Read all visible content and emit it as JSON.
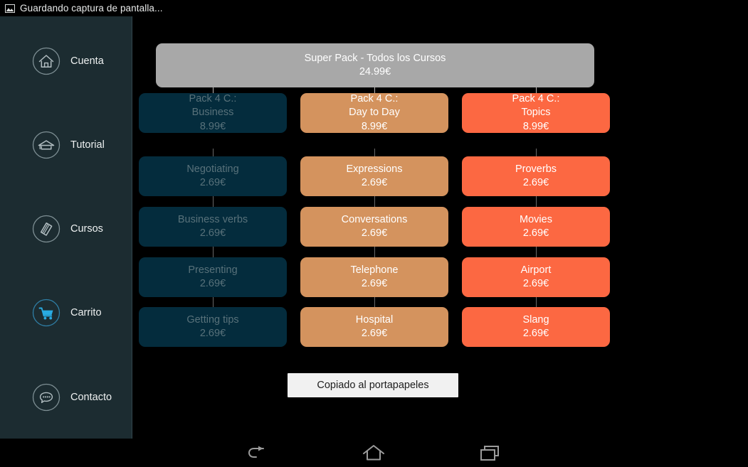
{
  "status_bar": {
    "icon": "screenshot-image-icon",
    "text": "Guardando captura de pantalla..."
  },
  "sidebar": {
    "background": "#1c2c31",
    "accent_color": "#29abe2",
    "items": [
      {
        "id": "cuenta",
        "label": "Cuenta",
        "icon": "home-icon",
        "active": false
      },
      {
        "id": "tutorial",
        "label": "Tutorial",
        "icon": "graduation-cap-icon",
        "active": false
      },
      {
        "id": "cursos",
        "label": "Cursos",
        "icon": "book-icon",
        "active": false
      },
      {
        "id": "carrito",
        "label": "Carrito",
        "icon": "shopping-cart-icon",
        "active": true
      },
      {
        "id": "contacto",
        "label": "Contacto",
        "icon": "chat-bubble-icon",
        "active": false
      }
    ]
  },
  "main": {
    "background": "#000000",
    "root_node": {
      "title": "Super Pack - Todos los Cursos",
      "price": "24.99€",
      "color": "#a8a8a8"
    },
    "columns": [
      {
        "id": "business",
        "color": "#042c3d",
        "text_color": "#58717a",
        "header": {
          "line1": "Pack 4 C.:",
          "line2": "Business",
          "price": "8.99€"
        },
        "items": [
          {
            "title": "Negotiating",
            "price": "2.69€"
          },
          {
            "title": "Business verbs",
            "price": "2.69€"
          },
          {
            "title": "Presenting",
            "price": "2.69€"
          },
          {
            "title": "Getting tips",
            "price": "2.69€"
          }
        ]
      },
      {
        "id": "day-to-day",
        "color": "#d4935e",
        "text_color": "#ffffff",
        "header": {
          "line1": "Pack 4 C.:",
          "line2": "Day to Day",
          "price": "8.99€"
        },
        "items": [
          {
            "title": "Expressions",
            "price": "2.69€"
          },
          {
            "title": "Conversations",
            "price": "2.69€"
          },
          {
            "title": "Telephone",
            "price": "2.69€"
          },
          {
            "title": "Hospital",
            "price": "2.69€"
          }
        ]
      },
      {
        "id": "topics",
        "color": "#fc6842",
        "text_color": "#ffffff",
        "header": {
          "line1": "Pack 4 C.:",
          "line2": "Topics",
          "price": "8.99€"
        },
        "items": [
          {
            "title": "Proverbs",
            "price": "2.69€"
          },
          {
            "title": "Movies",
            "price": "2.69€"
          },
          {
            "title": "Airport",
            "price": "2.69€"
          },
          {
            "title": "Slang",
            "price": "2.69€"
          }
        ]
      }
    ],
    "toast": {
      "text": "Copiado al portapapeles"
    }
  },
  "navbar": {
    "buttons": [
      {
        "id": "back",
        "icon": "back-arrow-icon"
      },
      {
        "id": "home",
        "icon": "home-outline-icon"
      },
      {
        "id": "recents",
        "icon": "recent-apps-icon"
      }
    ]
  }
}
